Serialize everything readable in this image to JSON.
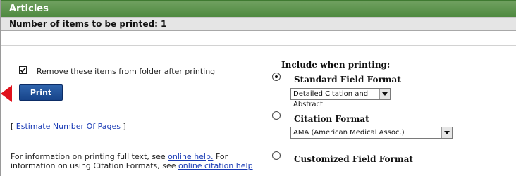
{
  "header": {
    "title": "Articles"
  },
  "subheader": {
    "text": "Number of items to be printed: 1"
  },
  "left": {
    "remove_checkbox": {
      "checked": true,
      "label": "Remove these items from folder after printing"
    },
    "print_button": {
      "label": "Print"
    },
    "estimate": {
      "open": "[ ",
      "link": "Estimate Number Of Pages",
      "close": " ]"
    },
    "info": {
      "line1_prefix": "For information on printing full text, see ",
      "line1_link": "online help.",
      "line1_suffix": " For",
      "line2_prefix": "information on using Citation Formats, see ",
      "line2_link": "online citation help"
    }
  },
  "right": {
    "title": "Include when printing:",
    "options": [
      {
        "label": "Standard Field Format",
        "selected": true,
        "select_value": "Detailed Citation and Abstract"
      },
      {
        "label": "Citation Format",
        "selected": false,
        "select_value": "AMA (American Medical Assoc.)"
      },
      {
        "label": "Customized Field Format",
        "selected": false
      }
    ]
  },
  "colors": {
    "header_green": "#5a9449",
    "button_blue": "#1f4f9a",
    "link_blue": "#1a3bb5",
    "arrow_red": "#e0121c"
  },
  "icons": {
    "pointer_arrow": "red-arrow-icon",
    "dropdown": "chevron-down-icon"
  }
}
